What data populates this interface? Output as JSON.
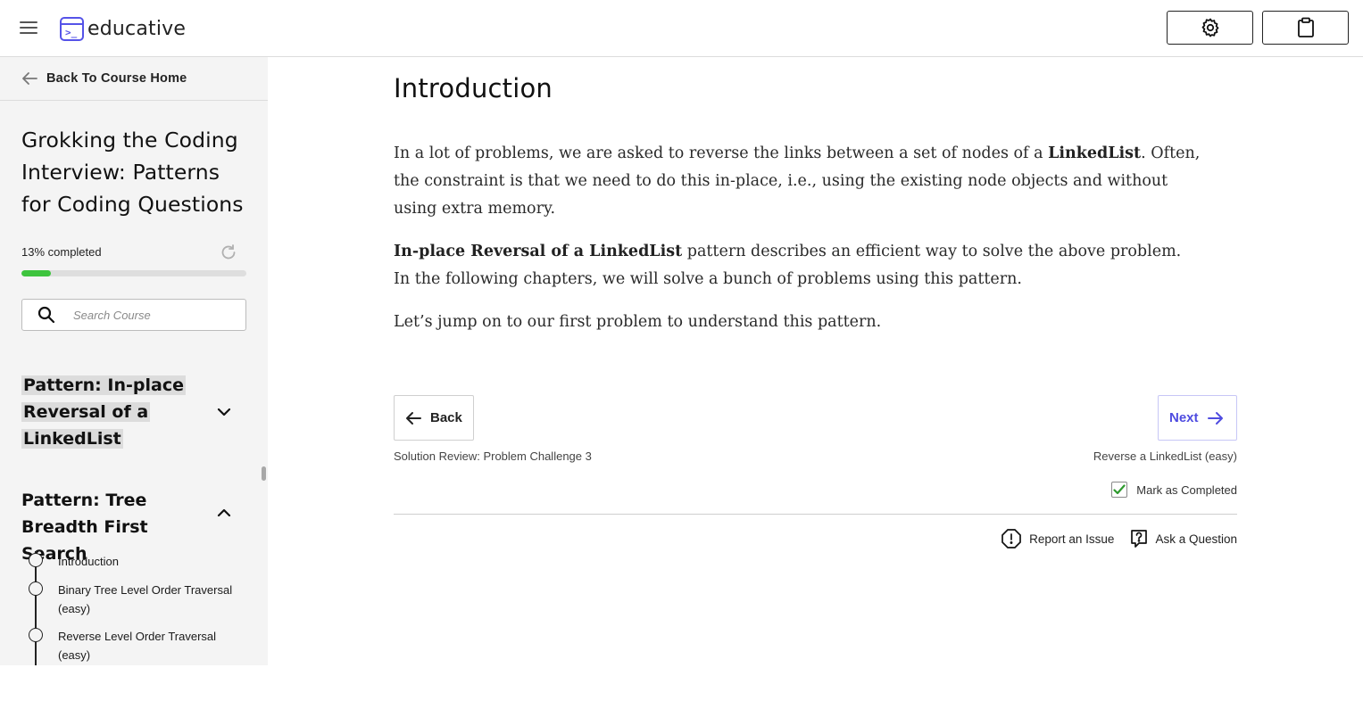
{
  "header": {
    "logo_text": "educative",
    "menu_icon": "hamburger-menu-icon",
    "settings_icon": "gear-icon",
    "clipboard_icon": "clipboard-icon",
    "brand_color": "#5553e8"
  },
  "sidebar": {
    "back_label": "Back To Course Home",
    "course_title": "Grokking the Coding Interview: Patterns for Coding Questions",
    "progress_label": "13% completed",
    "progress_fraction": 0.13,
    "progress_color": "#3ec43e",
    "search_placeholder": "Search Course",
    "sections": [
      {
        "title": "Pattern: In-place Reversal of a LinkedList",
        "expanded": false,
        "active": true
      },
      {
        "title": "Pattern: Tree Breadth First Search",
        "expanded": true,
        "active": false
      }
    ],
    "lessons": [
      {
        "title": "Introduction"
      },
      {
        "title": "Binary Tree Level Order Traversal (easy)"
      },
      {
        "title": "Reverse Level Order Traversal (easy)"
      }
    ]
  },
  "main": {
    "title": "Introduction",
    "para1_a": "In a lot of problems, we are asked to reverse the links between a set of nodes of a ",
    "para1_b": "LinkedList",
    "para1_c": ". Often, the constraint is that we need to do this in-place, i.e., using the existing node objects and without using extra memory.",
    "para2_a": "In-place Reversal of a LinkedList",
    "para2_b": " pattern describes an efficient way to solve the above problem. In the following chapters, we will solve a bunch of problems using this pattern.",
    "para3": "Let’s jump on to our first problem to understand this pattern.",
    "back_label": "Back",
    "back_sub": "Solution Review: Problem Challenge 3",
    "next_label": "Next",
    "next_sub": "Reverse a LinkedList (easy)",
    "next_color": "#4f4ce0",
    "mark_completed_label": "Mark as Completed",
    "mark_completed_checked": true,
    "report_label": "Report an Issue",
    "ask_label": "Ask a Question"
  }
}
